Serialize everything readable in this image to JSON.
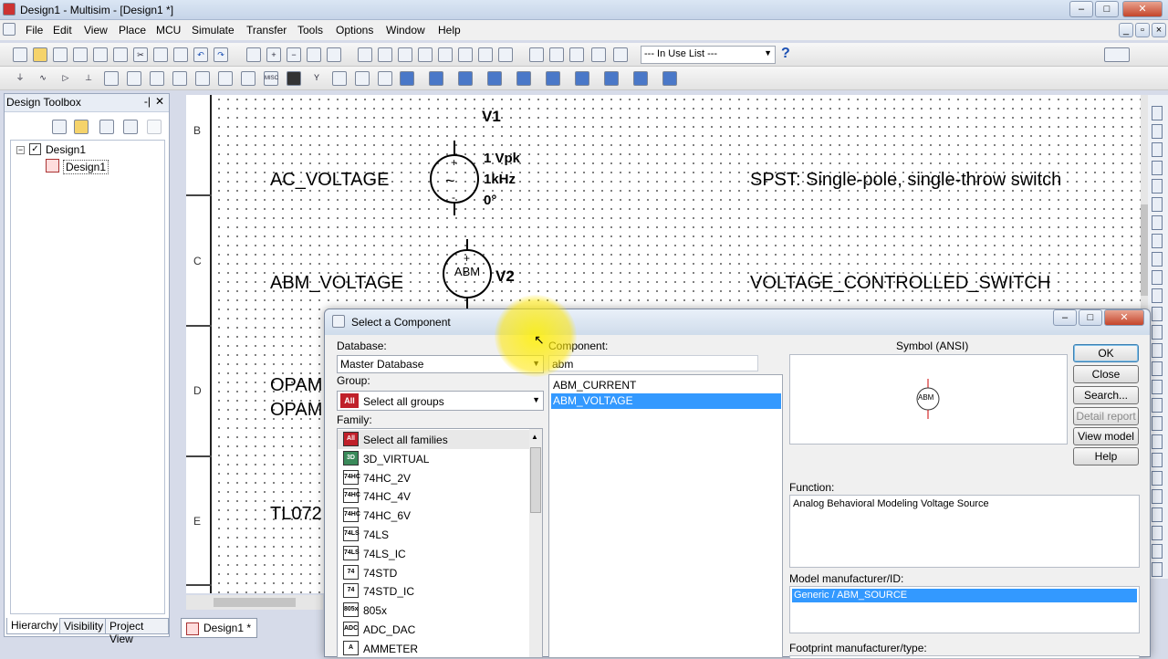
{
  "window": {
    "title": "Design1 - Multisim - [Design1 *]"
  },
  "menu": [
    "File",
    "Edit",
    "View",
    "Place",
    "MCU",
    "Simulate",
    "Transfer",
    "Tools",
    "Options",
    "Window",
    "Help"
  ],
  "toolbar": {
    "in_use_list": "--- In Use List ---"
  },
  "toolbox": {
    "title": "Design Toolbox",
    "tree_root": "Design1",
    "tree_child": "Design1",
    "tabs": [
      "Hierarchy",
      "Visibility",
      "Project View"
    ]
  },
  "doc_tab": "Design1 *",
  "canvas": {
    "row_labels": [
      "B",
      "C",
      "D",
      "E"
    ],
    "texts": {
      "ac_voltage": "AC_VOLTAGE",
      "abm_voltage": "ABM_VOLTAGE",
      "opam1": "OPAM",
      "opam2": "OPAM",
      "tl072": "TL072",
      "spst": "SPST: Single-pole, single-throw switch",
      "vcs": "VOLTAGE_CONTROLLED_SWITCH",
      "v1": "V1",
      "v1_amp": "1 Vpk",
      "v1_freq": "1kHz",
      "v1_phase": "0°",
      "v2": "V2",
      "abm_symbol": "ABM"
    }
  },
  "dialog": {
    "title": "Select a Component",
    "database_label": "Database:",
    "database_value": "Master Database",
    "component_label": "Component:",
    "component_value": "abm",
    "group_label": "Group:",
    "group_value": "Select all groups",
    "group_icon": "All",
    "family_label": "Family:",
    "families": [
      {
        "icon": "All",
        "label": "Select all families",
        "color": "#c0202a"
      },
      {
        "icon": "3D",
        "label": "3D_VIRTUAL",
        "color": "#3a8a5a"
      },
      {
        "icon": "74HC",
        "label": "74HC_2V",
        "color": "#ffffff"
      },
      {
        "icon": "74HC",
        "label": "74HC_4V",
        "color": "#ffffff"
      },
      {
        "icon": "74HC",
        "label": "74HC_6V",
        "color": "#ffffff"
      },
      {
        "icon": "74LS",
        "label": "74LS",
        "color": "#ffffff"
      },
      {
        "icon": "74LS",
        "label": "74LS_IC",
        "color": "#ffffff"
      },
      {
        "icon": "74",
        "label": "74STD",
        "color": "#ffffff"
      },
      {
        "icon": "74",
        "label": "74STD_IC",
        "color": "#ffffff"
      },
      {
        "icon": "805x",
        "label": "805x",
        "color": "#ffffff"
      },
      {
        "icon": "ADC",
        "label": "ADC_DAC",
        "color": "#ffffff"
      },
      {
        "icon": "A",
        "label": "AMMETER",
        "color": "#ffffff"
      }
    ],
    "components": [
      "ABM_CURRENT",
      "ABM_VOLTAGE"
    ],
    "selected_component": "ABM_VOLTAGE",
    "symbol_label": "Symbol (ANSI)",
    "symbol_text": "ABM",
    "buttons": {
      "ok": "OK",
      "close": "Close",
      "search": "Search...",
      "detail": "Detail report",
      "view_model": "View model",
      "help": "Help"
    },
    "function_label": "Function:",
    "function_value": "Analog Behavioral Modeling Voltage Source",
    "model_label": "Model manufacturer/ID:",
    "model_value": "Generic / ABM_SOURCE",
    "footprint_label": "Footprint manufacturer/type:"
  }
}
